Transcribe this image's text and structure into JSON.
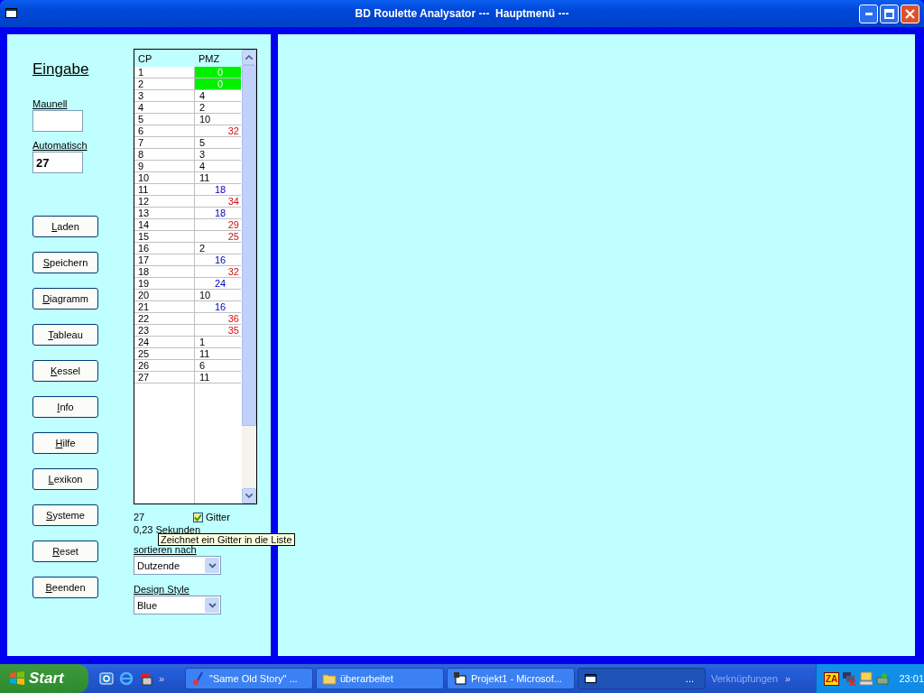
{
  "window": {
    "title": "BD Roulette Analysator ---  Hauptmenü ---"
  },
  "input": {
    "heading": "Eingabe",
    "manual_label": "Maunell",
    "auto_label": "Automatisch",
    "auto_value": "27"
  },
  "buttons": [
    "Laden",
    "Speichern",
    "Diagramm",
    "Tableau",
    "Kessel",
    "Info",
    "Hilfe",
    "Lexikon",
    "Systeme",
    "Reset",
    "Beenden"
  ],
  "table": {
    "columns": [
      "CP",
      "PMZ"
    ],
    "rows": [
      {
        "cp": "1",
        "pmz": "0",
        "kind": "zero"
      },
      {
        "cp": "2",
        "pmz": "0",
        "kind": "zero"
      },
      {
        "cp": "3",
        "pmz": "4",
        "kind": "low"
      },
      {
        "cp": "4",
        "pmz": "2",
        "kind": "low"
      },
      {
        "cp": "5",
        "pmz": "10",
        "kind": "low"
      },
      {
        "cp": "6",
        "pmz": "32",
        "kind": "high"
      },
      {
        "cp": "7",
        "pmz": "5",
        "kind": "low"
      },
      {
        "cp": "8",
        "pmz": "3",
        "kind": "low"
      },
      {
        "cp": "9",
        "pmz": "4",
        "kind": "low"
      },
      {
        "cp": "10",
        "pmz": "11",
        "kind": "low"
      },
      {
        "cp": "11",
        "pmz": "18",
        "kind": "mid"
      },
      {
        "cp": "12",
        "pmz": "34",
        "kind": "high"
      },
      {
        "cp": "13",
        "pmz": "18",
        "kind": "mid"
      },
      {
        "cp": "14",
        "pmz": "29",
        "kind": "high"
      },
      {
        "cp": "15",
        "pmz": "25",
        "kind": "high"
      },
      {
        "cp": "16",
        "pmz": "2",
        "kind": "low"
      },
      {
        "cp": "17",
        "pmz": "16",
        "kind": "mid"
      },
      {
        "cp": "18",
        "pmz": "32",
        "kind": "high"
      },
      {
        "cp": "19",
        "pmz": "24",
        "kind": "mid"
      },
      {
        "cp": "20",
        "pmz": "10",
        "kind": "low"
      },
      {
        "cp": "21",
        "pmz": "16",
        "kind": "mid"
      },
      {
        "cp": "22",
        "pmz": "36",
        "kind": "high"
      },
      {
        "cp": "23",
        "pmz": "35",
        "kind": "high"
      },
      {
        "cp": "24",
        "pmz": "1",
        "kind": "low"
      },
      {
        "cp": "25",
        "pmz": "11",
        "kind": "low"
      },
      {
        "cp": "26",
        "pmz": "6",
        "kind": "low"
      },
      {
        "cp": "27",
        "pmz": "11",
        "kind": "low"
      }
    ]
  },
  "count": "27",
  "grid_checkbox": {
    "label": "Gitter",
    "checked": true
  },
  "duration": "0,23 Sekunden",
  "tooltip": "Zeichnet ein Gitter in die Liste",
  "sort": {
    "label": "sortieren nach",
    "value": "Dutzende"
  },
  "design": {
    "label": "Design Style",
    "value": "Blue"
  },
  "taskbar": {
    "start": "Start",
    "more_quicklaunch": "»",
    "tasks": [
      {
        "label": "\"Same Old Story\" ...",
        "selected": false,
        "kind": "media"
      },
      {
        "label": "überarbeitet",
        "selected": false,
        "kind": "folder"
      },
      {
        "label": "Projekt1 - Microsof...",
        "selected": false,
        "kind": "vb"
      },
      {
        "label": "...",
        "selected": true,
        "kind": "app"
      }
    ],
    "toolbar": "Verknüpfungen",
    "toolbar_more": "»",
    "tray_za": "ZA",
    "clock": "23:01"
  }
}
